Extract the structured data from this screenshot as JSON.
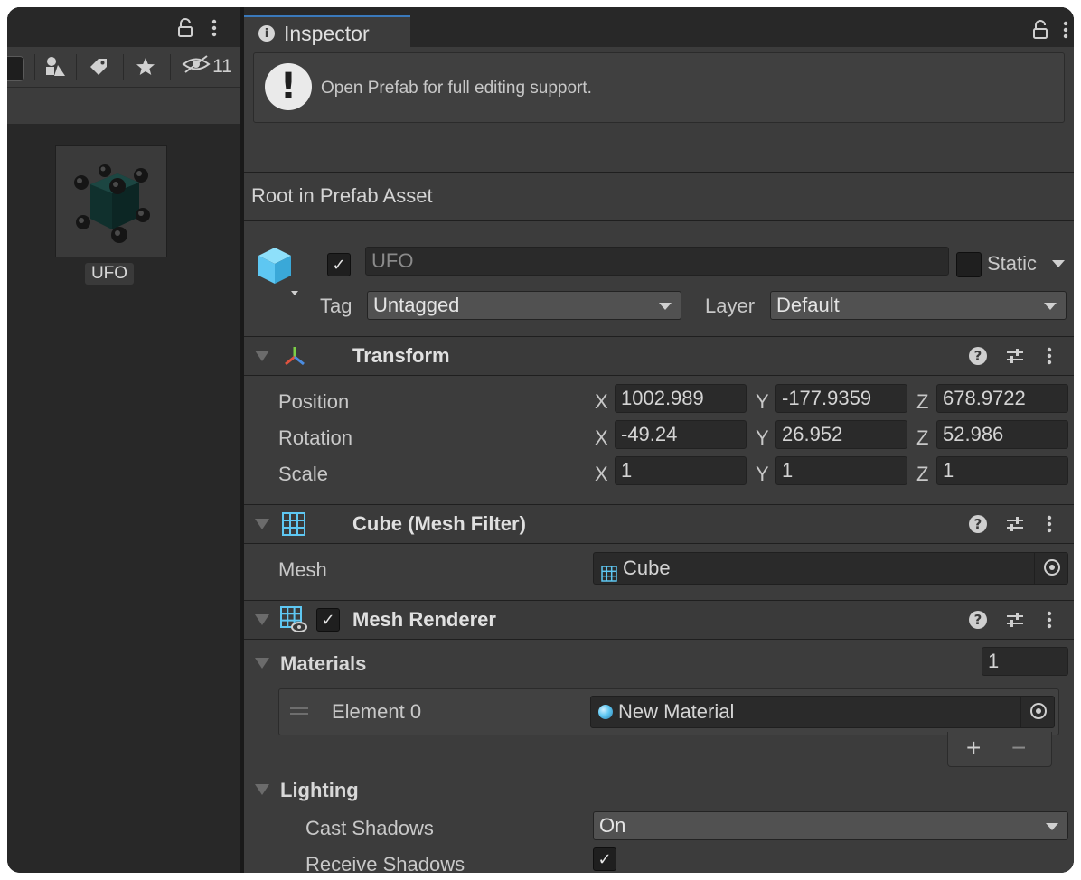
{
  "project_panel": {
    "hidden_count": "11",
    "toolbar_icons": [
      "filter-by-type-icon",
      "filter-by-label-icon",
      "favorite-star-icon",
      "hidden-visibility-icon"
    ],
    "asset": {
      "name": "UFO"
    }
  },
  "inspector": {
    "tab_title": "Inspector",
    "help_message": "Open Prefab for full editing support.",
    "root_label": "Root in Prefab Asset",
    "game_object": {
      "active": true,
      "name": "UFO",
      "static_label": "Static",
      "static": false,
      "tag_label": "Tag",
      "tag_value": "Untagged",
      "layer_label": "Layer",
      "layer_value": "Default"
    },
    "transform": {
      "title": "Transform",
      "rows": [
        {
          "label": "Position",
          "x": "1002.989",
          "y": "-177.9359",
          "z": "678.9722"
        },
        {
          "label": "Rotation",
          "x": "-49.24",
          "y": "26.952",
          "z": "52.986"
        },
        {
          "label": "Scale",
          "x": "1",
          "y": "1",
          "z": "1"
        }
      ],
      "axis_x": "X",
      "axis_y": "Y",
      "axis_z": "Z"
    },
    "mesh_filter": {
      "title": "Cube (Mesh Filter)",
      "mesh_label": "Mesh",
      "mesh_value": "Cube"
    },
    "mesh_renderer": {
      "title": "Mesh Renderer",
      "enabled": true,
      "materials_label": "Materials",
      "materials_count": "1",
      "element_label": "Element 0",
      "element_value": "New Material",
      "add_label": "+",
      "remove_label": "−",
      "lighting_label": "Lighting",
      "cast_shadows_label": "Cast Shadows",
      "cast_shadows_value": "On",
      "receive_shadows_label": "Receive Shadows",
      "receive_shadows": true
    }
  },
  "colors": {
    "accent_blue": "#3a79bb",
    "cube_icon": "#5ec7f2"
  }
}
